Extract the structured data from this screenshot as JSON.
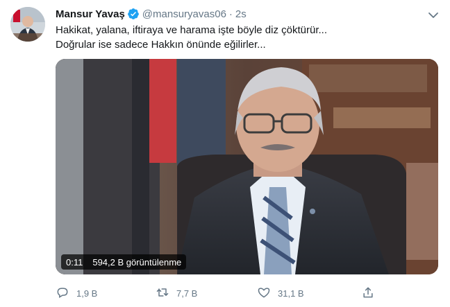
{
  "tweet": {
    "author_name": "Mansur Yavaş",
    "handle": "@mansuryavas06",
    "separator": "·",
    "time": "2s",
    "lines": [
      "Hakikat, yalana, iftiraya ve harama işte böyle diz çöktürür...",
      "Doğrular ise sadece Hakkın önünde eğilirler..."
    ]
  },
  "video": {
    "duration": "0:11",
    "views": "594,2 B görüntülenme"
  },
  "actions": {
    "reply_count": "1,9 B",
    "retweet_count": "7,7 B",
    "like_count": "31,1 B"
  },
  "colors": {
    "verified": "#1da1f2",
    "secondary_text": "#657786",
    "primary_text": "#14171a"
  },
  "icons": [
    "verified-badge-icon",
    "chevron-down-icon",
    "reply-icon",
    "retweet-icon",
    "like-icon",
    "share-icon"
  ]
}
